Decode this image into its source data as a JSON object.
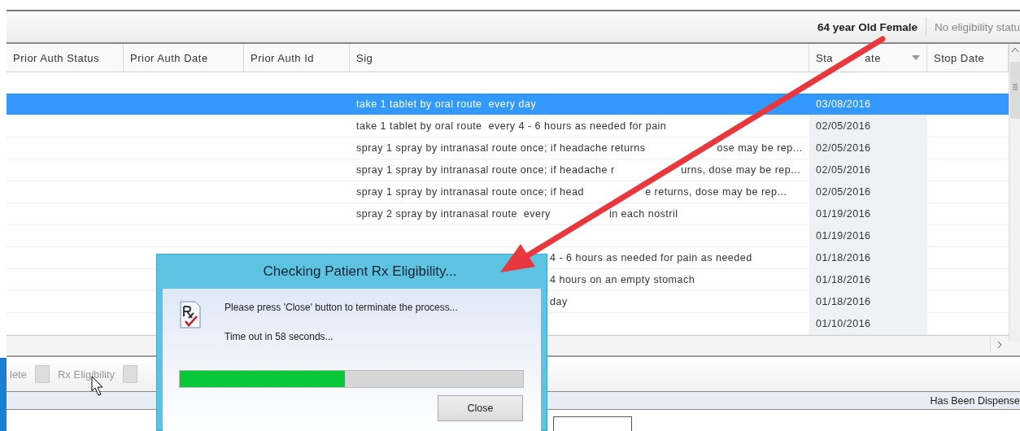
{
  "header": {
    "patient": "64 year Old Female",
    "eligibility": "No eligibility statu"
  },
  "table": {
    "columns": [
      {
        "label": "Prior Auth Status",
        "sorted": false
      },
      {
        "label": "Prior Auth Date",
        "sorted": false
      },
      {
        "label": "Prior Auth Id",
        "sorted": false
      },
      {
        "label": "Sig",
        "sorted": false
      },
      {
        "label_parts": [
          "Sta",
          "ate"
        ],
        "sorted": true
      },
      {
        "label": "Stop Date",
        "sorted": false
      }
    ],
    "rows": [
      {
        "sig": "take 1 tablet by oral route  every day",
        "start_date": "03/08/2016",
        "selected": true,
        "covered": false
      },
      {
        "sig": "take 1 tablet by oral route  every 4 - 6 hours as needed for pain",
        "start_date": "02/05/2016",
        "selected": false,
        "covered": false
      },
      {
        "sig_parts": [
          "spray 1 spray by intranasal route once; if headache returns",
          "ose may be rep..."
        ],
        "start_date": "02/05/2016",
        "selected": false,
        "covered": false
      },
      {
        "sig_parts": [
          "spray 1 spray by intranasal route once; if headache r",
          "urns, dose may be rep..."
        ],
        "start_date": "02/05/2016",
        "selected": false,
        "covered": false
      },
      {
        "sig_parts": [
          "spray 1 spray by intranasal route once; if head",
          "e returns, dose may be rep..."
        ],
        "start_date": "02/05/2016",
        "selected": false,
        "covered": false
      },
      {
        "sig_parts": [
          "spray 2 spray by intranasal route  every",
          "in each nostril"
        ],
        "start_date": "01/19/2016",
        "selected": false,
        "covered": false
      },
      {
        "start_date": "01/19/2016",
        "selected": false,
        "covered": false
      },
      {
        "sig": "4 - 6 hours as needed for pain as needed",
        "start_date": "01/18/2016",
        "selected": false,
        "covered": true
      },
      {
        "sig": "4 hours on an empty stomach",
        "start_date": "01/18/2016",
        "selected": false,
        "covered": true
      },
      {
        "sig": "day",
        "start_date": "01/18/2016",
        "selected": false,
        "covered": true
      },
      {
        "start_date": "01/10/2016",
        "selected": false,
        "covered": false
      }
    ]
  },
  "toolbar": {
    "items": [
      {
        "label": "lete"
      },
      {
        "label": "Rx Eligibility"
      }
    ]
  },
  "status": {
    "text": "Has Been Dispense"
  },
  "dialog": {
    "title": "Checking Patient Rx Eligibility...",
    "message": "Please press 'Close' button to terminate the process...",
    "timeout": "Time out in 58 seconds...",
    "level": 0.48,
    "button": "Close"
  }
}
